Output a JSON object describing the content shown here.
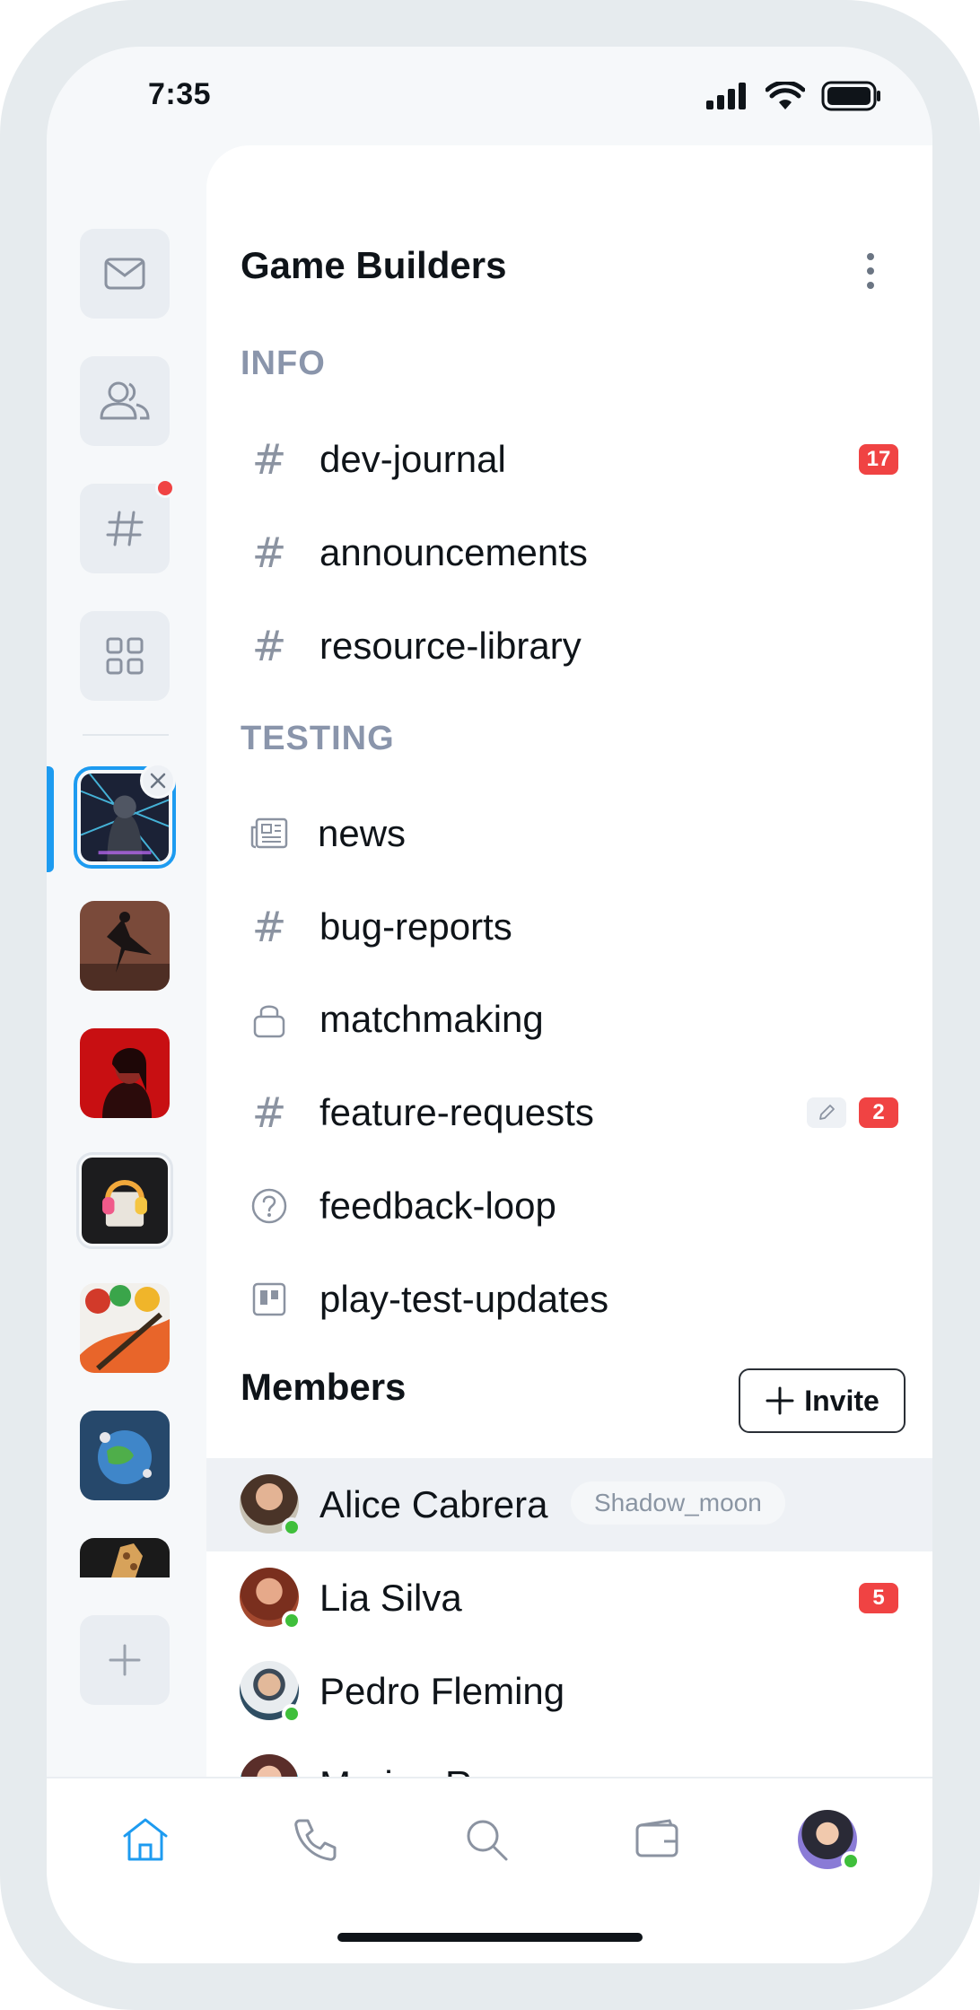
{
  "status_bar": {
    "time": "7:35"
  },
  "server": {
    "name": "Game Builders",
    "sections": [
      {
        "title": "INFO",
        "channels": [
          {
            "name": "dev-journal",
            "icon": "hash-icon",
            "badge": "17"
          },
          {
            "name": "announcements",
            "icon": "hash-icon"
          },
          {
            "name": "resource-library",
            "icon": "hash-icon"
          }
        ]
      },
      {
        "title": "TESTING",
        "channels": [
          {
            "name": "news",
            "icon": "newspaper-icon"
          },
          {
            "name": "bug-reports",
            "icon": "hash-icon"
          },
          {
            "name": "matchmaking",
            "icon": "lock-icon"
          },
          {
            "name": "feature-requests",
            "icon": "hash-icon",
            "badge": "2",
            "draft": true
          },
          {
            "name": "feedback-loop",
            "icon": "question-circle-icon"
          },
          {
            "name": "play-test-updates",
            "icon": "board-icon"
          }
        ]
      }
    ]
  },
  "members": {
    "title": "Members",
    "invite_label": "Invite",
    "list": [
      {
        "name": "Alice Cabrera",
        "tag": "Shadow_moon",
        "status": "online",
        "selected": true
      },
      {
        "name": "Lia Silva",
        "badge": "5",
        "status": "online"
      },
      {
        "name": "Pedro Fleming",
        "status": "online"
      },
      {
        "name": "Marina Roman",
        "status": "online"
      }
    ]
  },
  "colors": {
    "accent": "#1d9bf0",
    "badge": "#f04343",
    "online": "#3fbf3b",
    "section": "#8a95ab"
  }
}
